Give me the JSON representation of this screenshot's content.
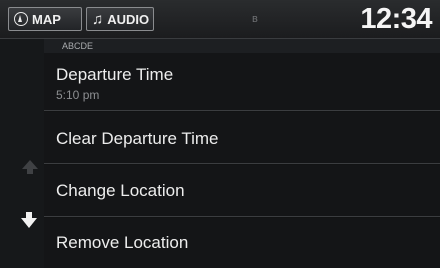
{
  "header": {
    "map_label": "MAP",
    "audio_label": "AUDIO",
    "clock": "12:34"
  },
  "list": {
    "subheading": "ABCDE",
    "items": [
      {
        "label": "Departure Time",
        "sub": "5:10 pm"
      },
      {
        "label": "Clear Departure Time"
      },
      {
        "label": "Change Location"
      },
      {
        "label": "Remove Location"
      }
    ]
  },
  "icons": {
    "map": "compass-icon",
    "audio": "music-note-icon",
    "bluetooth": "bluetooth-icon",
    "scroll_up": "scroll-up-arrow-icon",
    "scroll_down": "scroll-down-arrow-icon"
  }
}
